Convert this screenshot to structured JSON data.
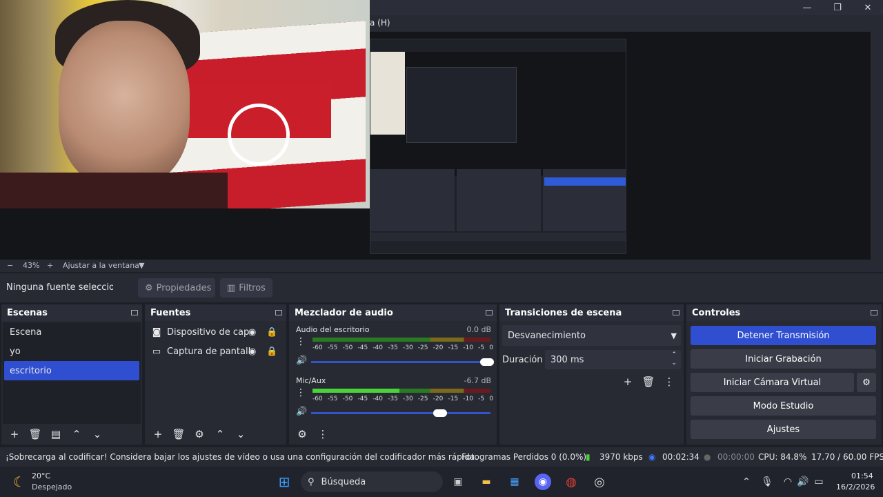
{
  "window": {
    "menu_visible": "a (H)"
  },
  "preview": {
    "zoom": "43%",
    "fit_label": "Ajustar a la ventana"
  },
  "source_toolbar": {
    "no_selection": "Ninguna fuente seleccionada",
    "properties": "Propiedades",
    "filters": "Filtros"
  },
  "docks": {
    "scenes": {
      "title": "Escenas",
      "items": [
        "Escena",
        "yo",
        "escritorio"
      ],
      "selected_index": 2
    },
    "sources": {
      "title": "Fuentes",
      "items": [
        {
          "label": "Dispositivo de captura",
          "icon": "camera-icon"
        },
        {
          "label": "Captura de pantalla",
          "icon": "monitor-icon"
        }
      ]
    },
    "mixer": {
      "title": "Mezclador de audio",
      "channels": [
        {
          "name": "Audio del escritorio",
          "db": "0.0 dB",
          "level": 0.0,
          "volume": 0.98
        },
        {
          "name": "Mic/Aux",
          "db": "-6.7 dB",
          "level": 0.49,
          "volume": 0.72
        }
      ],
      "scale": [
        "-60",
        "-55",
        "-50",
        "-45",
        "-40",
        "-35",
        "-30",
        "-25",
        "-20",
        "-15",
        "-10",
        "-5",
        "0"
      ]
    },
    "transitions": {
      "title": "Transiciones de escena",
      "selected": "Desvanecimiento",
      "duration_label": "Duración",
      "duration_value": "300 ms"
    },
    "controls": {
      "title": "Controles",
      "stop_stream": "Detener Transmisión",
      "start_record": "Iniciar Grabación",
      "start_virtualcam": "Iniciar Cámara Virtual",
      "studio_mode": "Modo Estudio",
      "settings": "Ajustes"
    }
  },
  "status": {
    "warning": "¡Sobrecarga al codificar! Considera bajar los ajustes de vídeo o usa una configuración del codificador más rápida.",
    "dropped": "Fotogramas Perdidos 0 (0.0%)",
    "bitrate": "3970 kbps",
    "stream_time": "00:02:34",
    "record_time": "00:00:00",
    "cpu": "CPU: 84.8%",
    "fps": "17.70 / 60.00 FPS"
  },
  "taskbar": {
    "weather_temp": "20°C",
    "weather_desc": "Despejado",
    "search_placeholder": "Búsqueda",
    "time": "01:54",
    "date": "16/2/2026"
  }
}
